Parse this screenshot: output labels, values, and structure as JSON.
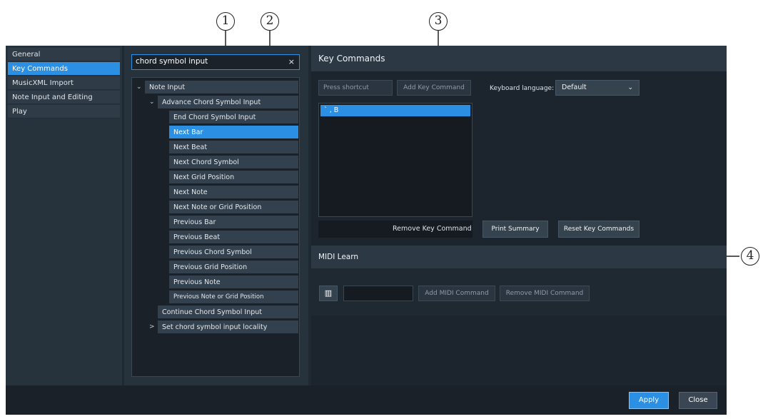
{
  "callouts": [
    "1",
    "2",
    "3",
    "4"
  ],
  "categories": [
    {
      "label": "General",
      "selected": false
    },
    {
      "label": "Key Commands",
      "selected": true
    },
    {
      "label": "MusicXML Import",
      "selected": false
    },
    {
      "label": "Note Input and Editing",
      "selected": false
    },
    {
      "label": "Play",
      "selected": false
    }
  ],
  "search": {
    "value": "chord symbol input",
    "clear_icon": "×"
  },
  "tree": {
    "root": "Note Input",
    "group": "Advance Chord Symbol Input",
    "children": [
      "End Chord Symbol Input",
      "Next Bar",
      "Next Beat",
      "Next Chord Symbol",
      "Next Grid Position",
      "Next Note",
      "Next Note or Grid Position",
      "Previous Bar",
      "Previous Beat",
      "Previous Chord Symbol",
      "Previous Grid Position",
      "Previous Note",
      "Previous Note or Grid Position"
    ],
    "selected_child": "Next Bar",
    "sibling1": "Continue Chord Symbol Input",
    "sibling2": "Set chord symbol input locality",
    "expanded_glyph": "⌄",
    "collapsed_glyph": ">"
  },
  "key_commands": {
    "title": "Key Commands",
    "shortcut_placeholder": "Press shortcut",
    "add_label": "Add Key Command",
    "language_label": "Keyboard language:",
    "language_value": "Default",
    "entries": [
      "` , B"
    ],
    "remove_label": "Remove Key Command",
    "print_label": "Print Summary",
    "reset_label": "Reset Key Commands"
  },
  "midi": {
    "title": "MIDI Learn",
    "add_label": "Add MIDI Command",
    "remove_label": "Remove MIDI Command"
  },
  "footer": {
    "apply_label": "Apply",
    "close_label": "Close"
  },
  "colors": {
    "accent": "#2b8fe3",
    "background": "#1f2932"
  }
}
